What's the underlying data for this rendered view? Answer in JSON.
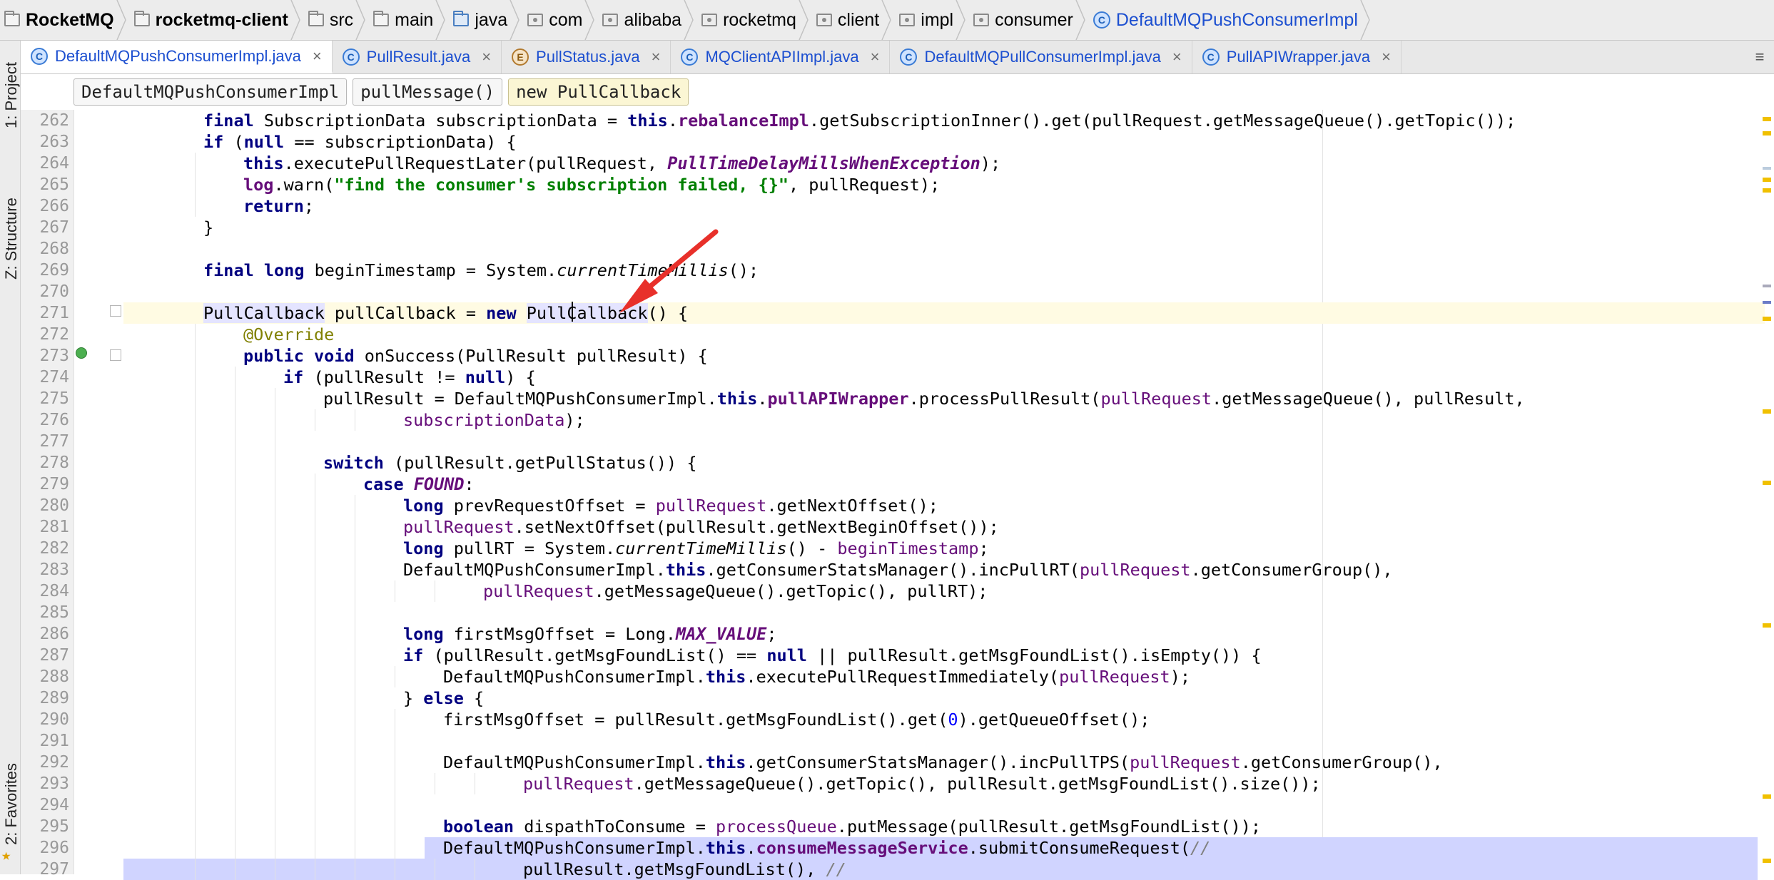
{
  "breadcrumbs": [
    {
      "label": "RocketMQ",
      "icon": "folder-icon",
      "bold": true
    },
    {
      "label": "rocketmq-client",
      "icon": "folder-icon",
      "bold": true
    },
    {
      "label": "src",
      "icon": "folder-icon"
    },
    {
      "label": "main",
      "icon": "folder-icon"
    },
    {
      "label": "java",
      "icon": "source-folder-icon"
    },
    {
      "label": "com",
      "icon": "package-icon"
    },
    {
      "label": "alibaba",
      "icon": "package-icon"
    },
    {
      "label": "rocketmq",
      "icon": "package-icon"
    },
    {
      "label": "client",
      "icon": "package-icon"
    },
    {
      "label": "impl",
      "icon": "package-icon"
    },
    {
      "label": "consumer",
      "icon": "package-icon"
    },
    {
      "label": "DefaultMQPushConsumerImpl",
      "icon": "class-icon"
    }
  ],
  "side_tabs": {
    "project": "1: Project",
    "structure": "Z: Structure",
    "favorites": "2: Favorites"
  },
  "tabs": [
    {
      "label": "DefaultMQPushConsumerImpl.java",
      "icon": "class-icon",
      "active": true
    },
    {
      "label": "PullResult.java",
      "icon": "class-icon"
    },
    {
      "label": "PullStatus.java",
      "icon": "enum-icon"
    },
    {
      "label": "MQClientAPIImpl.java",
      "icon": "class-icon"
    },
    {
      "label": "DefaultMQPullConsumerImpl.java",
      "icon": "class-icon"
    },
    {
      "label": "PullAPIWrapper.java",
      "icon": "class-icon"
    }
  ],
  "tab_close_glyph": "×",
  "tab_menu_glyph": "≡",
  "context": [
    "DefaultMQPushConsumerImpl",
    "pullMessage()",
    "new PullCallback"
  ],
  "lines": [
    {
      "n": "262",
      "i": 2,
      "t": [
        [
          "kw",
          "final "
        ],
        [
          "",
          "SubscriptionData subscriptionData = "
        ],
        [
          "kw",
          "this"
        ],
        [
          "",
          "."
        ],
        [
          "fldb",
          "rebalanceImpl"
        ],
        [
          "",
          ".getSubscriptionInner().get(pullRequest.getMessageQueue().getTopic());"
        ]
      ]
    },
    {
      "n": "263",
      "i": 2,
      "t": [
        [
          "kw",
          "if "
        ],
        [
          "",
          "("
        ],
        [
          "kw",
          "null "
        ],
        [
          "",
          "== subscriptionData) {"
        ]
      ]
    },
    {
      "n": "264",
      "i": 3,
      "t": [
        [
          "kw",
          "this"
        ],
        [
          "",
          ".executePullRequestLater(pullRequest, "
        ],
        [
          "st",
          "PullTimeDelayMillsWhenException"
        ],
        [
          "",
          ");"
        ]
      ]
    },
    {
      "n": "265",
      "i": 3,
      "t": [
        [
          "fldb",
          "log"
        ],
        [
          "",
          ".warn("
        ],
        [
          "str",
          "\"find the consumer's subscription failed, {}\""
        ],
        [
          "",
          ", pullRequest);"
        ]
      ]
    },
    {
      "n": "266",
      "i": 3,
      "t": [
        [
          "kw",
          "return"
        ],
        [
          "",
          ";"
        ]
      ]
    },
    {
      "n": "267",
      "i": 2,
      "t": [
        [
          "",
          "}"
        ]
      ]
    },
    {
      "n": "268",
      "i": 2,
      "t": []
    },
    {
      "n": "269",
      "i": 2,
      "t": [
        [
          "kw",
          "final long "
        ],
        [
          "",
          "beginTimestamp = System."
        ],
        [
          "itl",
          "currentTimeMillis"
        ],
        [
          "",
          "();"
        ]
      ]
    },
    {
      "n": "270",
      "i": 2,
      "t": []
    },
    {
      "n": "271",
      "i": 2,
      "cur": true,
      "t": [
        [
          "ref",
          "PullCallback"
        ],
        [
          "",
          " pullCallback = "
        ],
        [
          "kw",
          "new "
        ],
        [
          "ref",
          "PullCallback"
        ],
        [
          "",
          "() {"
        ]
      ]
    },
    {
      "n": "272",
      "i": 3,
      "t": [
        [
          "ann",
          "@Override"
        ]
      ]
    },
    {
      "n": "273",
      "i": 3,
      "t": [
        [
          "kw",
          "public void "
        ],
        [
          "",
          "onSuccess(PullResult pullResult) {"
        ]
      ]
    },
    {
      "n": "274",
      "i": 4,
      "t": [
        [
          "kw",
          "if "
        ],
        [
          "",
          "(pullResult != "
        ],
        [
          "kw",
          "null"
        ],
        [
          "",
          ") {"
        ]
      ]
    },
    {
      "n": "275",
      "i": 5,
      "t": [
        [
          "",
          "pullResult = DefaultMQPushConsumerImpl."
        ],
        [
          "kw",
          "this"
        ],
        [
          "",
          "."
        ],
        [
          "fldb",
          "pullAPIWrapper"
        ],
        [
          "",
          ".processPullResult("
        ],
        [
          "fld",
          "pullRequest"
        ],
        [
          "",
          ".getMessageQueue(), pullResult,"
        ]
      ]
    },
    {
      "n": "276",
      "i": 7,
      "t": [
        [
          "fld",
          "subscriptionData"
        ],
        [
          "",
          ");"
        ]
      ]
    },
    {
      "n": "277",
      "i": 5,
      "t": []
    },
    {
      "n": "278",
      "i": 5,
      "t": [
        [
          "kw",
          "switch "
        ],
        [
          "",
          "(pullResult.getPullStatus()) {"
        ]
      ]
    },
    {
      "n": "279",
      "i": 6,
      "t": [
        [
          "kw",
          "case "
        ],
        [
          "st",
          "FOUND"
        ],
        [
          "",
          ":"
        ]
      ]
    },
    {
      "n": "280",
      "i": 7,
      "t": [
        [
          "kw",
          "long "
        ],
        [
          "",
          "prevRequestOffset = "
        ],
        [
          "fld",
          "pullRequest"
        ],
        [
          "",
          ".getNextOffset();"
        ]
      ]
    },
    {
      "n": "281",
      "i": 7,
      "t": [
        [
          "fld",
          "pullRequest"
        ],
        [
          "",
          ".setNextOffset(pullResult.getNextBeginOffset());"
        ]
      ]
    },
    {
      "n": "282",
      "i": 7,
      "t": [
        [
          "kw",
          "long "
        ],
        [
          "",
          "pullRT = System."
        ],
        [
          "itl",
          "currentTimeMillis"
        ],
        [
          "",
          "() - "
        ],
        [
          "fld",
          "beginTimestamp"
        ],
        [
          "",
          ";"
        ]
      ]
    },
    {
      "n": "283",
      "i": 7,
      "t": [
        [
          "",
          "DefaultMQPushConsumerImpl."
        ],
        [
          "kw",
          "this"
        ],
        [
          "",
          ".getConsumerStatsManager().incPullRT("
        ],
        [
          "fld",
          "pullRequest"
        ],
        [
          "",
          ".getConsumerGroup(),"
        ]
      ]
    },
    {
      "n": "284",
      "i": 9,
      "t": [
        [
          "fld",
          "pullRequest"
        ],
        [
          "",
          ".getMessageQueue().getTopic(), pullRT);"
        ]
      ]
    },
    {
      "n": "285",
      "i": 7,
      "t": []
    },
    {
      "n": "286",
      "i": 7,
      "t": [
        [
          "kw",
          "long "
        ],
        [
          "",
          "firstMsgOffset = Long."
        ],
        [
          "st",
          "MAX_VALUE"
        ],
        [
          "",
          ";"
        ]
      ]
    },
    {
      "n": "287",
      "i": 7,
      "t": [
        [
          "kw",
          "if "
        ],
        [
          "",
          "(pullResult.getMsgFoundList() == "
        ],
        [
          "kw",
          "null "
        ],
        [
          "",
          "|| pullResult.getMsgFoundList().isEmpty()) {"
        ]
      ]
    },
    {
      "n": "288",
      "i": 8,
      "t": [
        [
          "",
          "DefaultMQPushConsumerImpl."
        ],
        [
          "kw",
          "this"
        ],
        [
          "",
          ".executePullRequestImmediately("
        ],
        [
          "fld",
          "pullRequest"
        ],
        [
          "",
          ");"
        ]
      ]
    },
    {
      "n": "289",
      "i": 7,
      "t": [
        [
          "",
          "} "
        ],
        [
          "kw",
          "else "
        ],
        [
          "",
          "{"
        ]
      ]
    },
    {
      "n": "290",
      "i": 8,
      "t": [
        [
          "",
          "firstMsgOffset = pullResult.getMsgFoundList().get("
        ],
        [
          "num",
          "0"
        ],
        [
          "",
          ").getQueueOffset();"
        ]
      ]
    },
    {
      "n": "291",
      "i": 8,
      "t": []
    },
    {
      "n": "292",
      "i": 8,
      "t": [
        [
          "",
          "DefaultMQPushConsumerImpl."
        ],
        [
          "kw",
          "this"
        ],
        [
          "",
          ".getConsumerStatsManager().incPullTPS("
        ],
        [
          "fld",
          "pullRequest"
        ],
        [
          "",
          ".getConsumerGroup(),"
        ]
      ]
    },
    {
      "n": "293",
      "i": 10,
      "t": [
        [
          "fld",
          "pullRequest"
        ],
        [
          "",
          ".getMessageQueue().getTopic(), pullResult.getMsgFoundList().size());"
        ]
      ]
    },
    {
      "n": "294",
      "i": 8,
      "t": []
    },
    {
      "n": "295",
      "i": 8,
      "t": [
        [
          "kw",
          "boolean "
        ],
        [
          "",
          "dispathToConsume = "
        ],
        [
          "fld",
          "processQueue"
        ],
        [
          "",
          ".putMessage(pullResult.getMsgFoundList());"
        ]
      ]
    },
    {
      "n": "296",
      "i": 8,
      "sel": "partial",
      "t": [
        [
          "",
          "DefaultMQPushConsumerImpl."
        ],
        [
          "kw",
          "this"
        ],
        [
          "",
          "."
        ],
        [
          "fldb",
          "consumeMessageService"
        ],
        [
          "",
          ".submitConsumeRequest("
        ],
        [
          "cm",
          "//"
        ]
      ]
    },
    {
      "n": "297",
      "i": 10,
      "sel": "full",
      "t": [
        [
          "",
          "pullResult.getMsgFoundList(), "
        ],
        [
          "cm",
          "//"
        ]
      ]
    }
  ]
}
